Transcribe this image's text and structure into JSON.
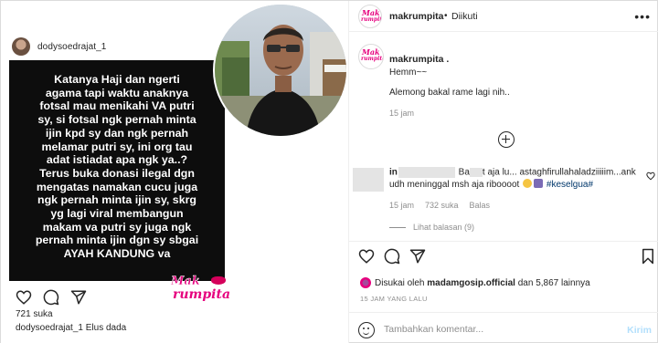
{
  "left": {
    "username": "dodysoedrajat_1",
    "quote_lines": [
      "Katanya Haji dan ngerti",
      "agama tapi waktu anaknya",
      "fotsal mau menikahi VA putri",
      "sy, si fotsal ngk pernah minta",
      "ijin kpd sy dan ngk pernah",
      "melamar putri sy, ini org tau",
      "adat istiadat apa ngk ya..?",
      "Terus buka donasi ilegal dgn",
      "mengatas namakan cucu juga",
      "ngk pernah minta ijin sy, skrg",
      "yg lagi viral membangun",
      "makam va putri sy juga ngk",
      "pernah minta ijin dgn sy sbgai",
      "AYAH KANDUNG va"
    ],
    "watermark_mak": "Mak",
    "watermark_rumpita": "rumpita",
    "likes": "721 suka",
    "caption_user": "dodysoedrajat_1",
    "caption_text": "Elus dada",
    "icons": [
      "heart-icon",
      "comment-icon",
      "share-icon"
    ]
  },
  "right": {
    "header": {
      "username": "makrumpita",
      "dot": "•",
      "follow_label": "Diikuti",
      "more": "•••"
    },
    "post": {
      "username": "makrumpita .",
      "line1": "Hemm~~",
      "line2": "Alemong bakal rame lagi nih..",
      "time": "15 jam"
    },
    "comment": {
      "user_prefix": "in",
      "text_a": "Ba",
      "text_b": "t aja lu... astaghfirullahaladziiiiim...ank",
      "text_line2": "udh meninggal msh aja riboooot",
      "hashtag": "#keselgua#",
      "time": "15 jam",
      "likes": "732 suka",
      "reply": "Balas",
      "view_replies": "Lihat balasan (9)"
    },
    "liked_by_prefix": "Disukai oleh",
    "liked_by_user": "madamgosip.official",
    "liked_by_suffix": "dan 5,867 lainnya",
    "posted_ago": "15 JAM YANG LALU",
    "comment_box": {
      "placeholder": "Tambahkan komentar...",
      "send_label": "Kirim"
    },
    "colors": {
      "brand_pink": "#e6007e",
      "link_blue": "#00376b",
      "send_disabled": "#b2dffc",
      "muted": "#8e8e8e"
    }
  }
}
